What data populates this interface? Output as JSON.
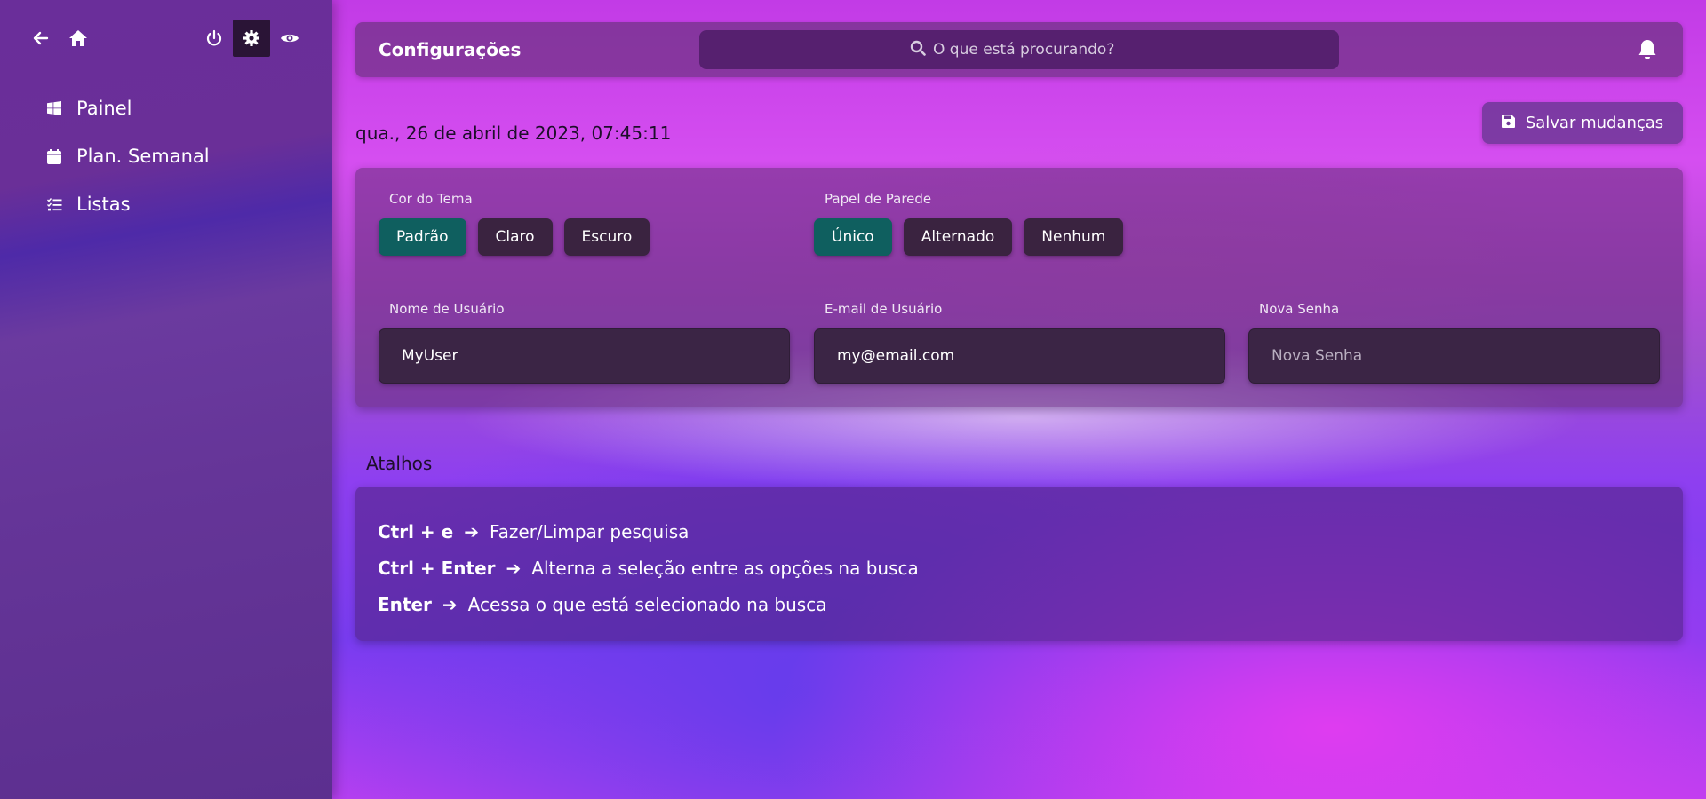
{
  "colors": {
    "selected_chip": "#0f5f5f",
    "chip": "#3a2340"
  },
  "sidebar": {
    "top_icons": [
      "arrow-left-icon",
      "home-icon",
      "power-icon",
      "gear-icon",
      "eye-icon"
    ],
    "items": [
      {
        "label": "Painel",
        "icon": "windows-icon"
      },
      {
        "label": "Plan. Semanal",
        "icon": "calendar-icon"
      },
      {
        "label": "Listas",
        "icon": "checklist-icon"
      }
    ]
  },
  "header": {
    "title": "Configurações",
    "search_placeholder": "O que está procurando?"
  },
  "datetime": "qua., 26 de abril de 2023, 07:45:11",
  "save_label": "Salvar mudanças",
  "settings": {
    "theme": {
      "label": "Cor do Tema",
      "options": [
        "Padrão",
        "Claro",
        "Escuro"
      ],
      "selected": "Padrão"
    },
    "wallpaper": {
      "label": "Papel de Parede",
      "options": [
        "Único",
        "Alternado",
        "Nenhum"
      ],
      "selected": "Único"
    },
    "username": {
      "label": "Nome de Usuário",
      "value": "MyUser"
    },
    "email": {
      "label": "E-mail de Usuário",
      "value": "my@email.com"
    },
    "password": {
      "label": "Nova Senha",
      "placeholder": "Nova Senha"
    }
  },
  "shortcuts": {
    "title": "Atalhos",
    "items": [
      {
        "key": "Ctrl + e",
        "desc": "Fazer/Limpar pesquisa"
      },
      {
        "key": "Ctrl + Enter",
        "desc": "Alterna a seleção entre as opções na busca"
      },
      {
        "key": "Enter",
        "desc": "Acessa o que está selecionado na busca"
      }
    ]
  }
}
